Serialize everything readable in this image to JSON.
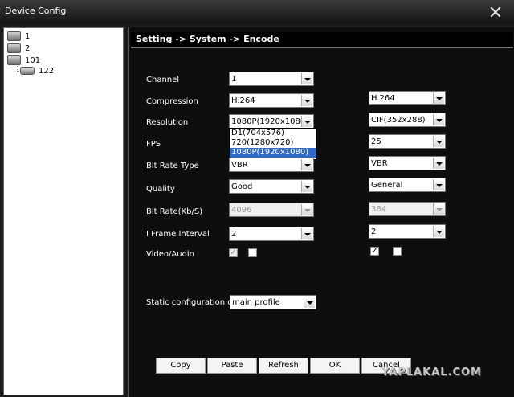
{
  "window": {
    "title": "Device Config"
  },
  "tree": {
    "items": [
      "1",
      "2",
      "101",
      "122"
    ]
  },
  "header": {
    "path": "Setting -> System -> Encode"
  },
  "labels": {
    "channel": "Channel",
    "compression": "Compression",
    "resolution": "Resolution",
    "fps": "FPS",
    "bitrate_type": "Bit Rate Type",
    "quality": "Quality",
    "bitrate": "Bit Rate(Kb/S)",
    "iframe": "I Frame Interval",
    "video_audio": "Video/Audio",
    "static_config": "Static configuration of"
  },
  "main": {
    "channel": "1",
    "compression": "H.264",
    "resolution": "1080P(1920x1080)",
    "bitrate_type": "VBR",
    "quality": "Good",
    "bitrate": "4096",
    "iframe": "2",
    "resolution_options": [
      "D1(704x576)",
      "720(1280x720)",
      "1080P(1920x1080)"
    ]
  },
  "extra": {
    "compression": "H.264",
    "resolution": "CIF(352x288)",
    "fps": "25",
    "bitrate_type": "VBR",
    "quality": "General",
    "bitrate": "384",
    "iframe": "2"
  },
  "static_config": {
    "value": "main profile"
  },
  "buttons": {
    "copy": "Copy",
    "paste": "Paste",
    "refresh": "Refresh",
    "ok": "OK",
    "cancel": "Cancel"
  },
  "watermark": "YAPLAKAL.COM"
}
